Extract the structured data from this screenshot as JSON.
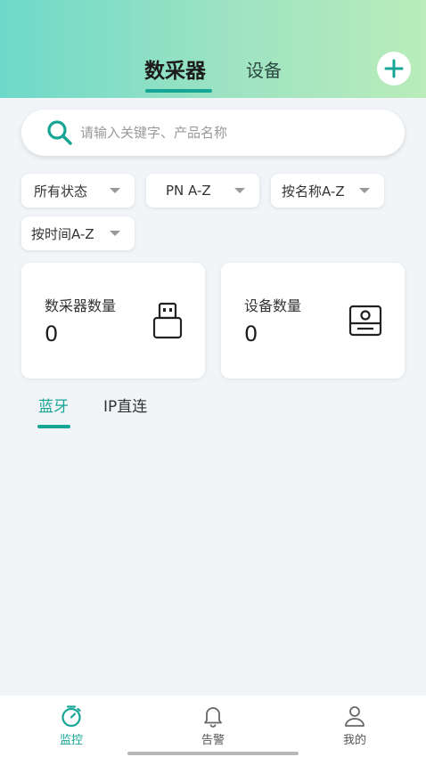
{
  "header": {
    "tabs": [
      {
        "label": "数采器",
        "active": true
      },
      {
        "label": "设备",
        "active": false
      }
    ],
    "add_icon": "plus-icon"
  },
  "search": {
    "placeholder": "请输入关键字、产品名称",
    "value": "",
    "icon": "search-icon"
  },
  "filters": [
    {
      "label": "所有状态"
    },
    {
      "label": "PN A-Z"
    },
    {
      "label": "按名称A-Z"
    },
    {
      "label": "按时间A-Z"
    }
  ],
  "stats": {
    "collectors": {
      "label": "数采器数量",
      "value": "0",
      "icon": "usb-dongle-icon"
    },
    "devices": {
      "label": "设备数量",
      "value": "0",
      "icon": "device-icon"
    }
  },
  "sub_tabs": [
    {
      "label": "蓝牙",
      "active": true
    },
    {
      "label": "IP直连",
      "active": false
    }
  ],
  "bottom_nav": [
    {
      "label": "监控",
      "icon": "stopwatch-icon",
      "active": true
    },
    {
      "label": "告警",
      "icon": "bell-icon",
      "active": false
    },
    {
      "label": "我的",
      "icon": "user-icon",
      "active": false
    }
  ],
  "colors": {
    "accent": "#17a695",
    "header_gradient_start": "#6ed9c9",
    "header_gradient_end": "#b9ecba",
    "background": "#f1f5f8"
  }
}
